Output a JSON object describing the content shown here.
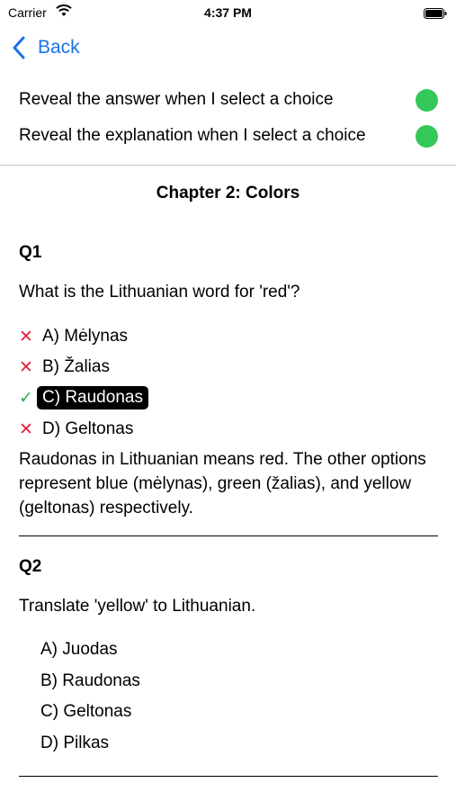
{
  "status_bar": {
    "carrier": "Carrier",
    "time": "4:37 PM"
  },
  "nav": {
    "back_label": "Back"
  },
  "settings": {
    "reveal_answer": {
      "label": "Reveal the answer when I select a choice",
      "on": true
    },
    "reveal_explanation": {
      "label": "Reveal the explanation when I select a choice",
      "on": true
    }
  },
  "chapter": {
    "title": "Chapter 2: Colors"
  },
  "questions": [
    {
      "label": "Q1",
      "text": "What is the Lithuanian word for 'red'?",
      "choices": [
        {
          "text": "A) Mėlynas",
          "mark": "✕",
          "selected": false
        },
        {
          "text": "B) Žalias",
          "mark": "✕",
          "selected": false
        },
        {
          "text": "C) Raudonas",
          "mark": "✓",
          "selected": true
        },
        {
          "text": "D) Geltonas",
          "mark": "✕",
          "selected": false
        }
      ],
      "explanation": "Raudonas in Lithuanian means red. The other options represent blue (mėlynas), green (žalias), and yellow (geltonas) respectively."
    },
    {
      "label": "Q2",
      "text": "Translate 'yellow' to Lithuanian.",
      "choices": [
        {
          "text": "A) Juodas"
        },
        {
          "text": "B) Raudonas"
        },
        {
          "text": "C) Geltonas"
        },
        {
          "text": "D) Pilkas"
        }
      ]
    }
  ],
  "colors": {
    "accent": "#1a73e8",
    "toggle_on": "#34c759",
    "wrong": "#e0243a",
    "correct": "#2fa94e"
  }
}
